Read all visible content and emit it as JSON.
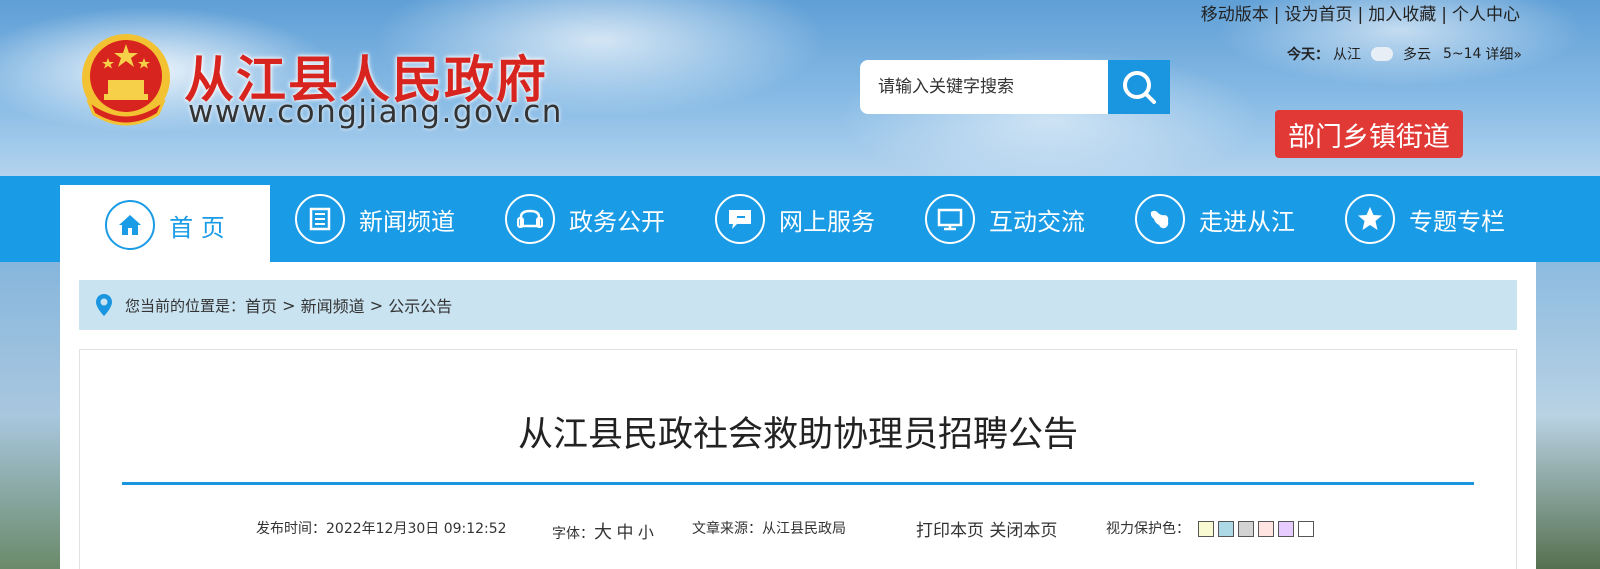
{
  "header": {
    "site_name": "从江县人民政府",
    "site_url": "www.congjiang.gov.cn",
    "top_links": [
      "移动版本",
      "设为首页",
      "加入收藏",
      "个人中心"
    ],
    "weather": {
      "prefix": "今天：",
      "city": "从江",
      "condition": "多云",
      "temp": "5~14",
      "detail": "详细»"
    },
    "search": {
      "placeholder": "请输入关键字搜索"
    },
    "dept_button": "部门乡镇街道"
  },
  "nav": {
    "items": [
      {
        "label": "首 页",
        "icon": "home-icon",
        "active": true
      },
      {
        "label": "新闻频道",
        "icon": "newspaper-icon",
        "active": false
      },
      {
        "label": "政务公开",
        "icon": "sofa-icon",
        "active": false
      },
      {
        "label": "网上服务",
        "icon": "chat-icon",
        "active": false
      },
      {
        "label": "互动交流",
        "icon": "monitor-icon",
        "active": false
      },
      {
        "label": "走进从江",
        "icon": "map-icon",
        "active": false
      },
      {
        "label": "专题专栏",
        "icon": "star-icon",
        "active": false
      }
    ]
  },
  "breadcrumb": {
    "prefix": "您当前的位置是：",
    "items": [
      "首页",
      "新闻频道",
      "公示公告"
    ],
    "separator": " > "
  },
  "article": {
    "title": "从江县民政社会救助协理员招聘公告",
    "publish_label": "发布时间：",
    "publish_time": "2022年12月30日 09:12:52",
    "font_label": "字体：",
    "font_sizes": [
      "大",
      "中",
      "小"
    ],
    "source_label": "文章来源：",
    "source": "从江县民政局",
    "print_label": "打印本页",
    "close_label": "关闭本页",
    "eye_label": "视力保护色：",
    "eye_colors": [
      "#fafad2",
      "#add8e6",
      "#d3d3d3",
      "#ffe4e1",
      "#e6ccff",
      "#ffffff"
    ]
  },
  "colors": {
    "nav_bg": "#1a9be6",
    "title_red": "#d8241f",
    "dept_red": "#e13a36",
    "breadcrumb_bg": "#c9e3f1"
  }
}
